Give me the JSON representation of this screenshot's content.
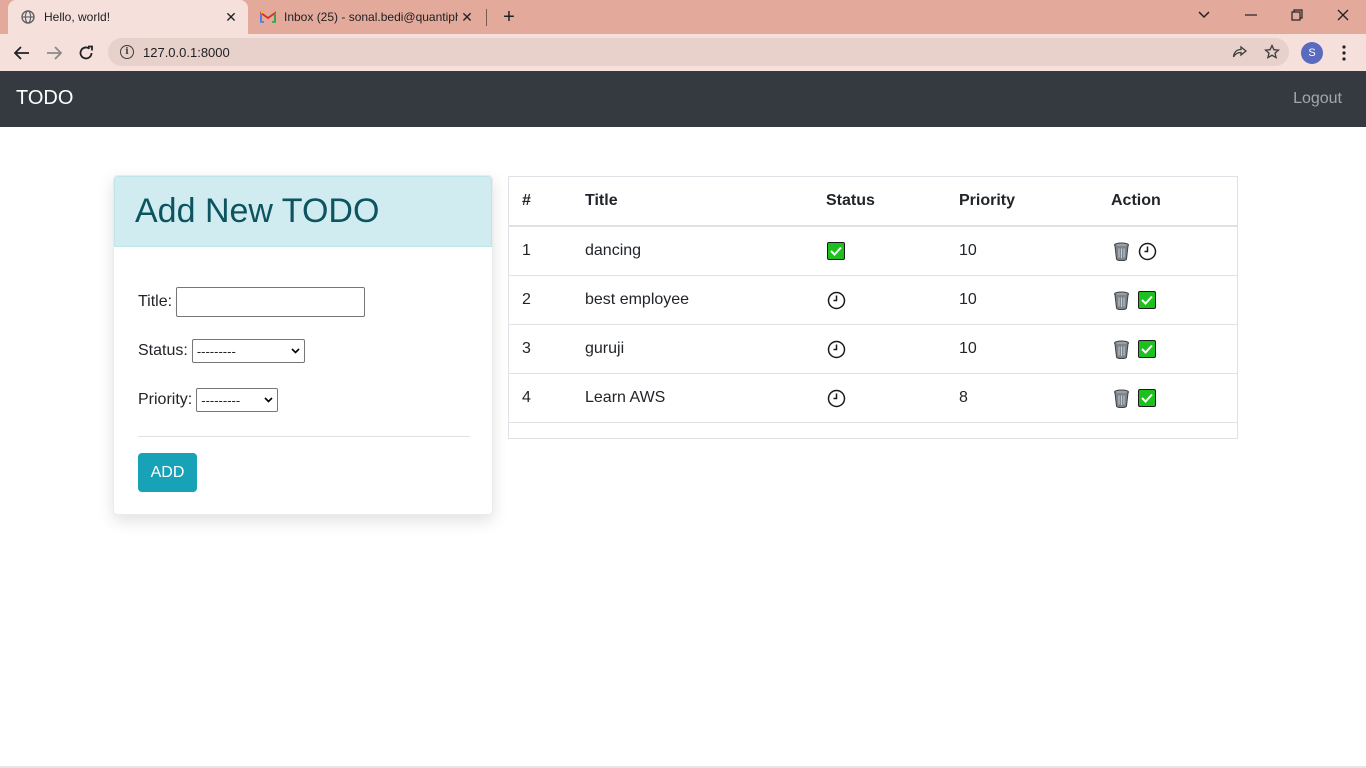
{
  "browser": {
    "tabs": [
      {
        "title": "Hello, world!",
        "active": true
      },
      {
        "title": "Inbox (25) - sonal.bedi@quantiphi",
        "active": false
      }
    ],
    "url": "127.0.0.1:8000",
    "profile_initial": "S"
  },
  "navbar": {
    "brand": "TODO",
    "logout": "Logout"
  },
  "form": {
    "heading": "Add New TODO",
    "title_label": "Title:",
    "title_value": "",
    "status_label": "Status:",
    "status_selected": "---------",
    "priority_label": "Priority:",
    "priority_selected": "---------",
    "add_button": "ADD"
  },
  "table": {
    "headers": [
      "#",
      "Title",
      "Status",
      "Priority",
      "Action"
    ],
    "rows": [
      {
        "num": "1",
        "title": "dancing",
        "status": "check-icon",
        "priority": "10",
        "actions": [
          "trash-icon",
          "clock-icon"
        ]
      },
      {
        "num": "2",
        "title": "best employee",
        "status": "clock-icon",
        "priority": "10",
        "actions": [
          "trash-icon",
          "check-icon"
        ]
      },
      {
        "num": "3",
        "title": "guruji",
        "status": "clock-icon",
        "priority": "10",
        "actions": [
          "trash-icon",
          "check-icon"
        ]
      },
      {
        "num": "4",
        "title": "Learn AWS",
        "status": "clock-icon",
        "priority": "8",
        "actions": [
          "trash-icon",
          "check-icon"
        ]
      }
    ]
  },
  "colors": {
    "navbar_bg": "#343a40",
    "card_header_bg": "#d1ecf1",
    "card_header_text": "#0c5460",
    "add_button_bg": "#17a2b8",
    "check_green": "#1fbf1f",
    "tabbar_bg": "#e3aa9b"
  }
}
